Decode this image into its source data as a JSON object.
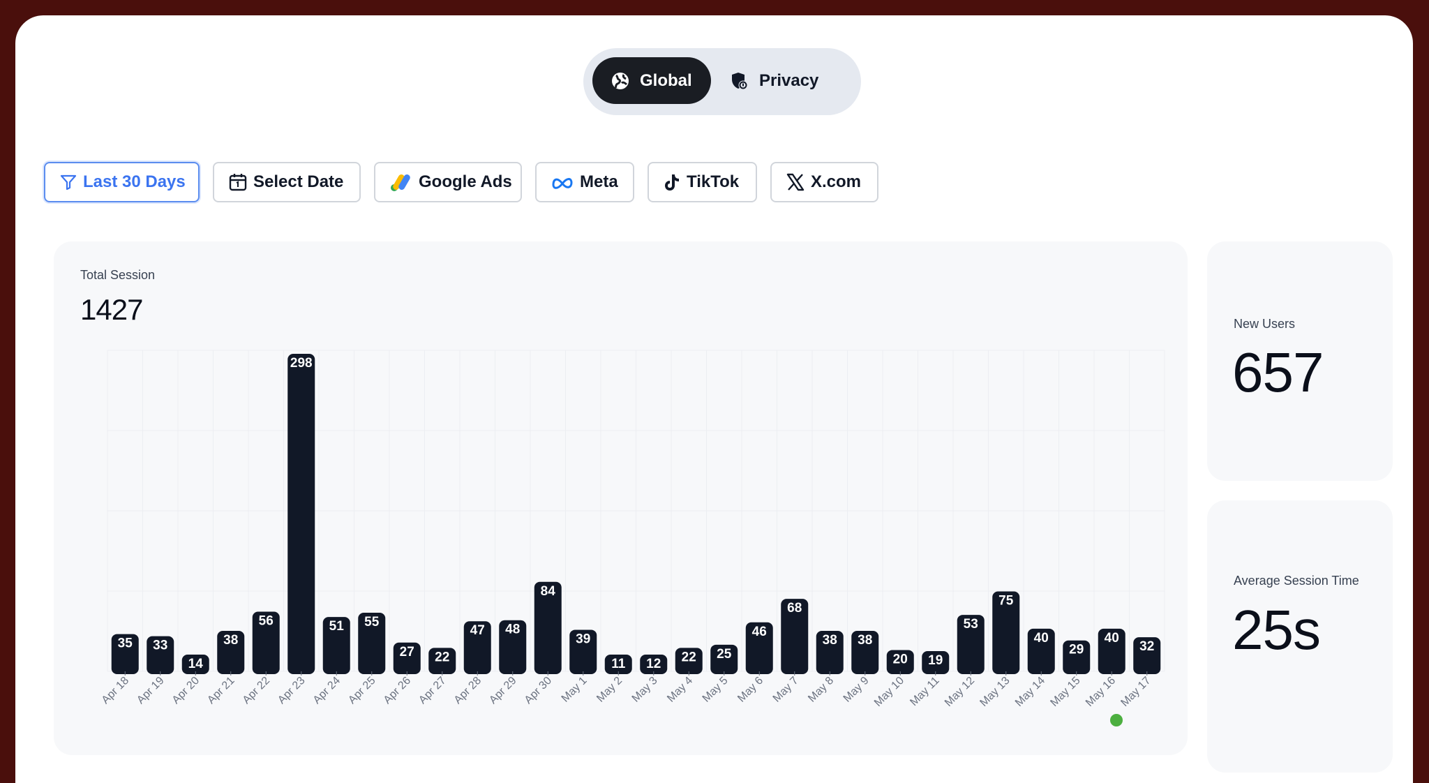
{
  "toggle": {
    "global_label": "Global",
    "privacy_label": "Privacy"
  },
  "filters": {
    "last30_label": "Last 30 Days",
    "select_date_label": "Select Date",
    "google_ads_label": "Google Ads",
    "meta_label": "Meta",
    "tiktok_label": "TikTok",
    "xcom_label": "X.com"
  },
  "metrics": {
    "total_session_label": "Total Session",
    "total_session_value": "1427",
    "new_users_label": "New Users",
    "new_users_value": "657",
    "avg_session_label": "Average Session Time",
    "avg_session_value": "25s"
  },
  "colors": {
    "bar": "#111827",
    "accent": "#3b74f0",
    "toggle_active": "#1a1d23",
    "status_dot": "#4caf3f",
    "frame": "#4a0f0c"
  },
  "chart_data": {
    "type": "bar",
    "categories": [
      "Apr 18",
      "Apr 19",
      "Apr 20",
      "Apr 21",
      "Apr 22",
      "Apr 23",
      "Apr 24",
      "Apr 25",
      "Apr 26",
      "Apr 27",
      "Apr 28",
      "Apr 29",
      "Apr 30",
      "May 1",
      "May 2",
      "May 3",
      "May 4",
      "May 5",
      "May 6",
      "May 7",
      "May 8",
      "May 9",
      "May 10",
      "May 11",
      "May 12",
      "May 13",
      "May 14",
      "May 15",
      "May 16",
      "May 17"
    ],
    "values": [
      35,
      33,
      14,
      38,
      56,
      298,
      51,
      55,
      27,
      22,
      47,
      48,
      84,
      39,
      11,
      12,
      22,
      25,
      46,
      68,
      38,
      38,
      20,
      19,
      53,
      75,
      40,
      29,
      40,
      32
    ],
    "data_labels": true,
    "grid": true,
    "ylim": [
      0,
      300
    ],
    "title": "",
    "xlabel": "",
    "ylabel": ""
  }
}
